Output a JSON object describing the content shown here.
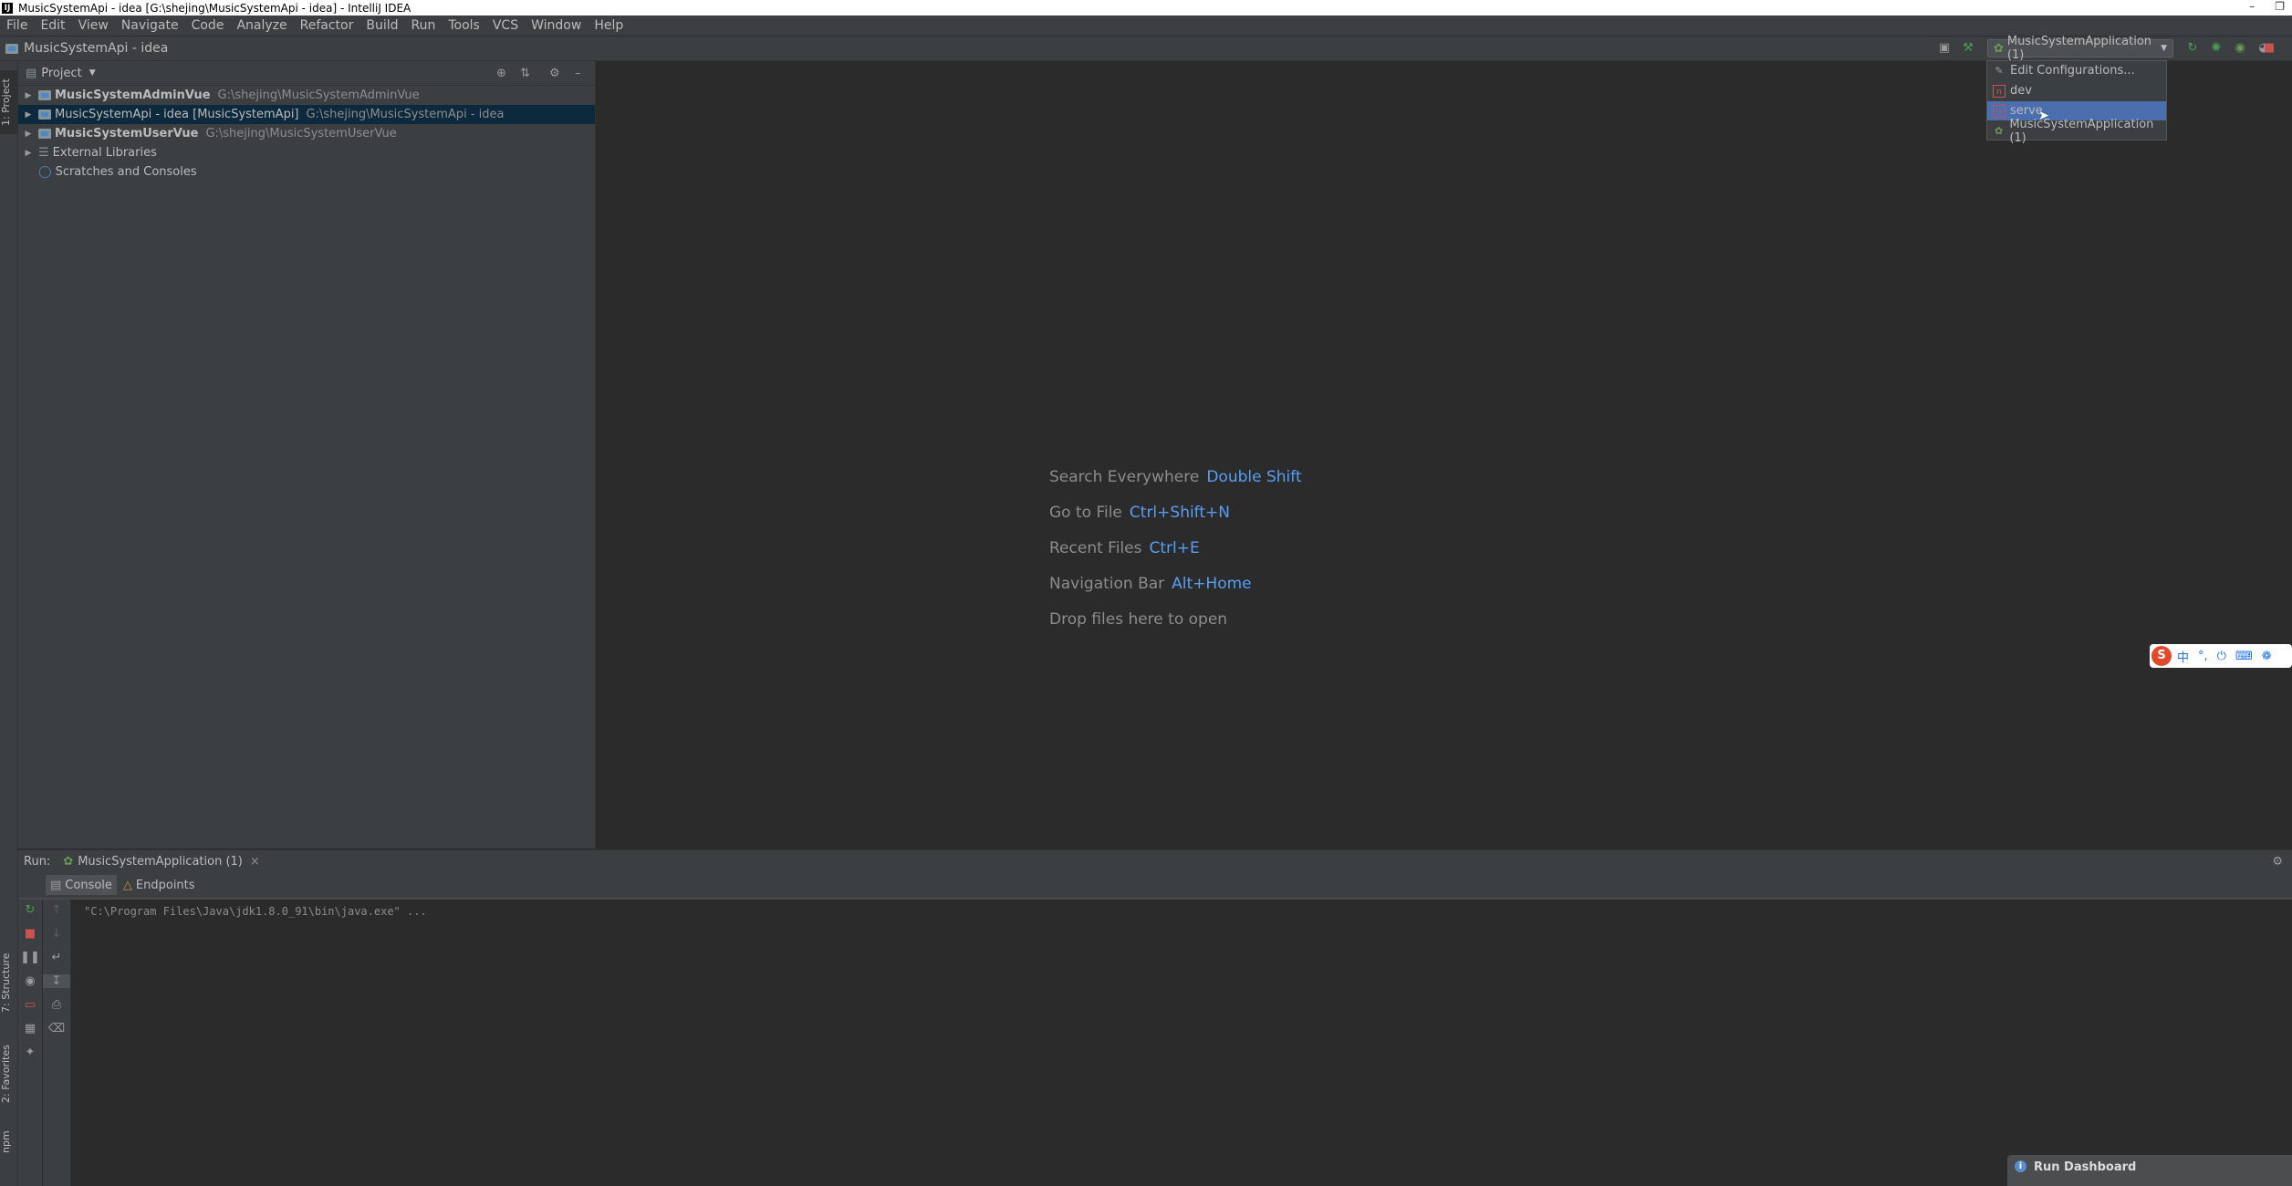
{
  "window": {
    "title": "MusicSystemApi - idea [G:\\shejing\\MusicSystemApi - idea] - IntelliJ IDEA",
    "app_icon_label": "IJ"
  },
  "menu": {
    "items": [
      "File",
      "Edit",
      "View",
      "Navigate",
      "Code",
      "Analyze",
      "Refactor",
      "Build",
      "Run",
      "Tools",
      "VCS",
      "Window",
      "Help"
    ]
  },
  "navbar": {
    "project_title": "MusicSystemApi - idea",
    "run_config": "MusicSystemApplication (1)"
  },
  "run_config_popup": {
    "items": [
      {
        "label": "Edit Configurations...",
        "icon": "pencil-icon"
      },
      {
        "label": "dev",
        "icon": "npm-icon"
      },
      {
        "label": "serve",
        "icon": "npm-icon",
        "selected": true
      },
      {
        "label": "MusicSystemApplication (1)",
        "icon": "spring-boot-icon"
      }
    ]
  },
  "left_strip": {
    "project_tab": "1: Project",
    "structure_tab": "7: Structure",
    "favorites_tab": "2: Favorites",
    "npm_tab": "npm"
  },
  "project_panel": {
    "header_label": "Project",
    "tree": [
      {
        "name": "MusicSystemAdminVue",
        "path": "G:\\shejing\\MusicSystemAdminVue"
      },
      {
        "name": "MusicSystemApi - idea [MusicSystemApi]",
        "path": "G:\\shejing\\MusicSystemApi - idea",
        "selected": true
      },
      {
        "name": "MusicSystemUserVue",
        "path": "G:\\shejing\\MusicSystemUserVue"
      },
      {
        "name": "External Libraries"
      },
      {
        "name": "Scratches and Consoles"
      }
    ]
  },
  "editor_hints": [
    {
      "label": "Search Everywhere",
      "key": "Double Shift"
    },
    {
      "label": "Go to File",
      "key": "Ctrl+Shift+N"
    },
    {
      "label": "Recent Files",
      "key": "Ctrl+E"
    },
    {
      "label": "Navigation Bar",
      "key": "Alt+Home"
    },
    {
      "label": "Drop files here to open",
      "key": ""
    }
  ],
  "run_panel": {
    "label": "Run:",
    "tab_name": "MusicSystemApplication (1)",
    "close_glyph": "×",
    "subtabs": [
      "Console",
      "Endpoints"
    ],
    "console_line": "\"C:\\Program Files\\Java\\jdk1.8.0_91\\bin\\java.exe\" ..."
  },
  "ime": {
    "logo": "S",
    "mode": "中"
  },
  "notification": {
    "title": "Run Dashboard"
  },
  "colors": {
    "accent": "#4b6eaf",
    "link": "#589df6",
    "selection": "#0d293e",
    "stop_red": "#c75450",
    "run_green": "#499c54"
  }
}
